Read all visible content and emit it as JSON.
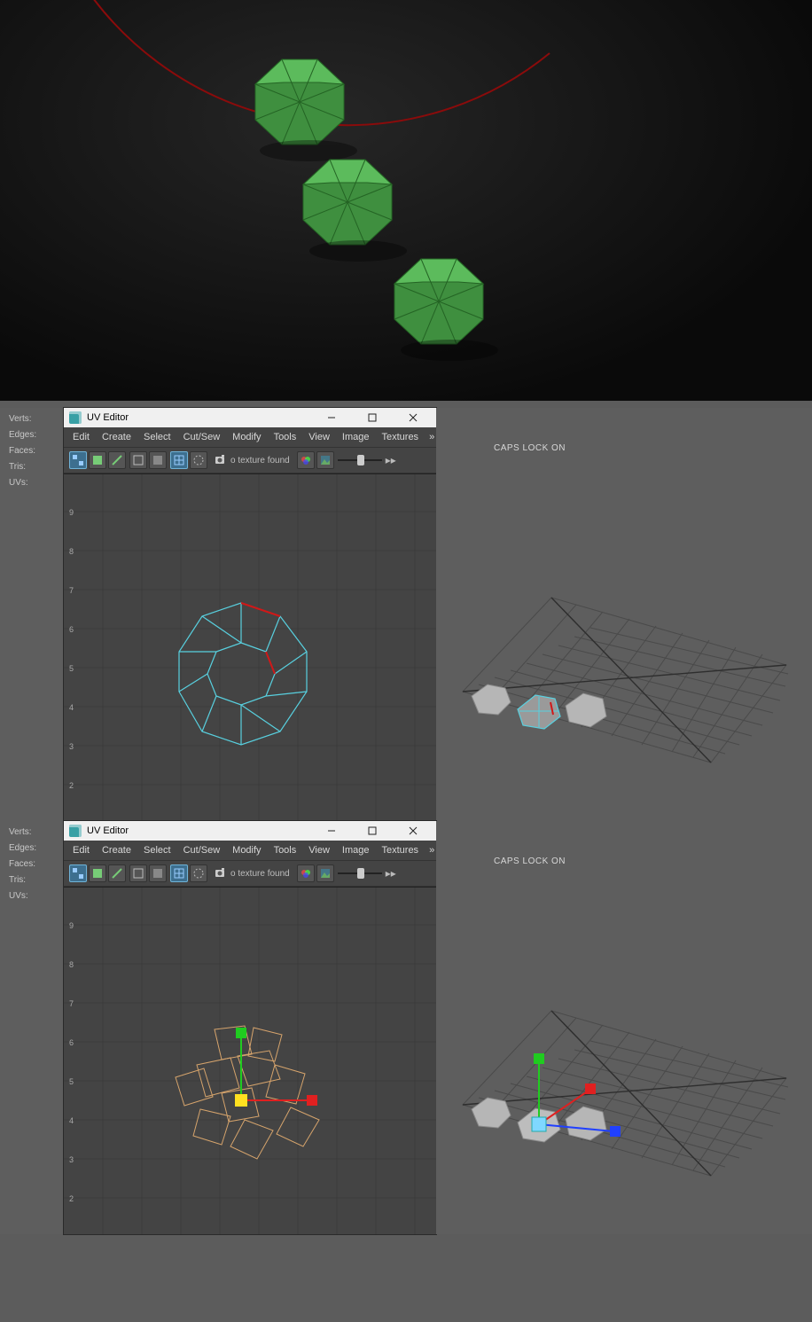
{
  "heads_up": {
    "verts_label": "Verts:",
    "edges_label": "Edges:",
    "faces_label": "Faces:",
    "tris_label": "Tris:",
    "uvs_label": "UVs:"
  },
  "uv_window": {
    "title": "UV Editor",
    "menus": {
      "edit": "Edit",
      "create": "Create",
      "select": "Select",
      "cutsew": "Cut/Sew",
      "modify": "Modify",
      "tools": "Tools",
      "view": "View",
      "image": "Image",
      "textures": "Textures",
      "more": "»"
    },
    "texture_msg": "o texture found"
  },
  "status": {
    "caps_lock": "CAPS LOCK ON"
  },
  "colors": {
    "accent_green": "#4ca64c",
    "accent_red": "#d01818",
    "uv_cyan": "#58d0df",
    "uv_orange": "#d6a46c",
    "gizmo_green": "#20cc20",
    "gizmo_red": "#e02020",
    "gizmo_blue": "#2040ff",
    "gizmo_yellow": "#ffe020"
  },
  "uv_axis": {
    "ticks_y": [
      "2",
      "3",
      "4",
      "5",
      "6",
      "7",
      "8",
      "9"
    ]
  }
}
